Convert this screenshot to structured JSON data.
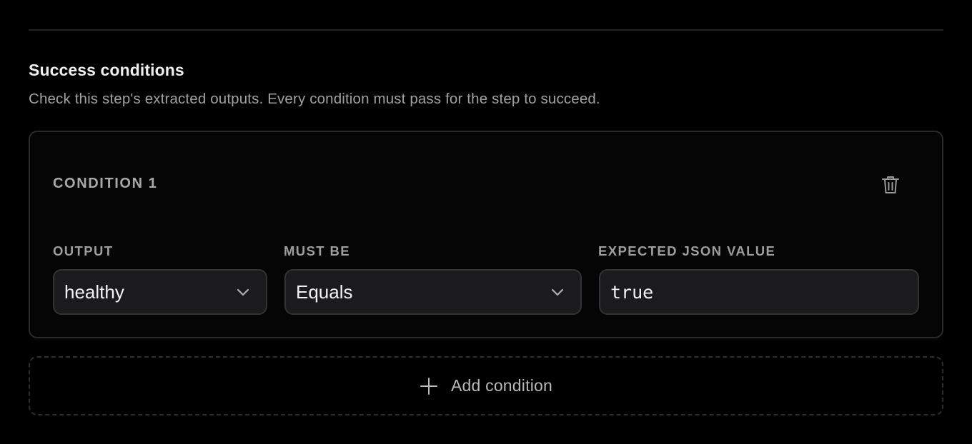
{
  "section": {
    "title": "Success conditions",
    "description": "Check this step's extracted outputs. Every condition must pass for the step to succeed."
  },
  "conditions": [
    {
      "title": "CONDITION 1",
      "delete_icon": "trash-icon",
      "output": {
        "label": "OUTPUT",
        "value": "healthy",
        "icon": "chevron-down-icon"
      },
      "must_be": {
        "label": "MUST BE",
        "value": "Equals",
        "icon": "chevron-down-icon"
      },
      "expected": {
        "label": "EXPECTED JSON VALUE",
        "value": "true"
      }
    }
  ],
  "add_condition": {
    "label": "Add condition",
    "icon": "plus-icon"
  },
  "colors": {
    "background": "#000000",
    "card_border": "#2a2a2a",
    "control_bg": "#1b1b1d",
    "text_primary": "#f2f2f2",
    "text_muted": "#a1a1a1"
  }
}
